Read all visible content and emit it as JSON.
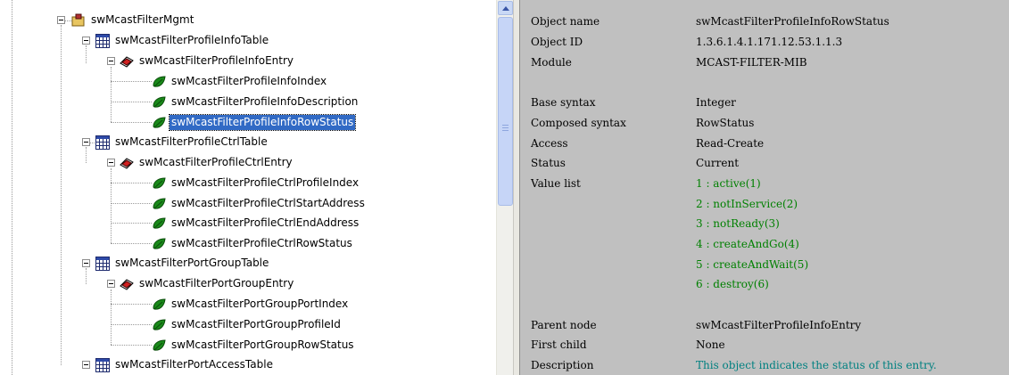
{
  "tree": {
    "root": "swMcastFilterMgmt",
    "profile_info_table": "swMcastFilterProfileInfoTable",
    "profile_info_entry": "swMcastFilterProfileInfoEntry",
    "profile_info_index": "swMcastFilterProfileInfoIndex",
    "profile_info_description": "swMcastFilterProfileInfoDescription",
    "profile_info_rowstatus": "swMcastFilterProfileInfoRowStatus",
    "profile_ctrl_table": "swMcastFilterProfileCtrlTable",
    "profile_ctrl_entry": "swMcastFilterProfileCtrlEntry",
    "profile_ctrl_profileindex": "swMcastFilterProfileCtrlProfileIndex",
    "profile_ctrl_startaddress": "swMcastFilterProfileCtrlStartAddress",
    "profile_ctrl_endaddress": "swMcastFilterProfileCtrlEndAddress",
    "profile_ctrl_rowstatus": "swMcastFilterProfileCtrlRowStatus",
    "port_group_table": "swMcastFilterPortGroupTable",
    "port_group_entry": "swMcastFilterPortGroupEntry",
    "port_group_portindex": "swMcastFilterPortGroupPortIndex",
    "port_group_profileid": "swMcastFilterPortGroupProfileId",
    "port_group_rowstatus": "swMcastFilterPortGroupRowStatus",
    "port_access_table": "swMcastFilterPortAccessTable"
  },
  "details": {
    "object_name_label": "Object name",
    "object_name_value": "swMcastFilterProfileInfoRowStatus",
    "object_id_label": "Object ID",
    "object_id_value": "1.3.6.1.4.1.171.12.53.1.1.3",
    "module_label": "Module",
    "module_value": "MCAST-FILTER-MIB",
    "base_syntax_label": "Base syntax",
    "base_syntax_value": "Integer",
    "composed_syntax_label": "Composed syntax",
    "composed_syntax_value": "RowStatus",
    "access_label": "Access",
    "access_value": "Read-Create",
    "status_label": "Status",
    "status_value": "Current",
    "value_list_label": "Value list",
    "value_list": [
      "1 : active(1)",
      "2 : notInService(2)",
      "3 : notReady(3)",
      "4 : createAndGo(4)",
      "5 : createAndWait(5)",
      "6 : destroy(6)"
    ],
    "parent_node_label": "Parent node",
    "parent_node_value": "swMcastFilterProfileInfoEntry",
    "first_child_label": "First child",
    "first_child_value": "None",
    "description_label": "Description",
    "description_value": "This object indicates the status of this entry."
  },
  "colors": {
    "selection": "#316ac5",
    "value_list_text": "#008000",
    "description_text": "#008080",
    "details_background": "#c0c0c0"
  }
}
